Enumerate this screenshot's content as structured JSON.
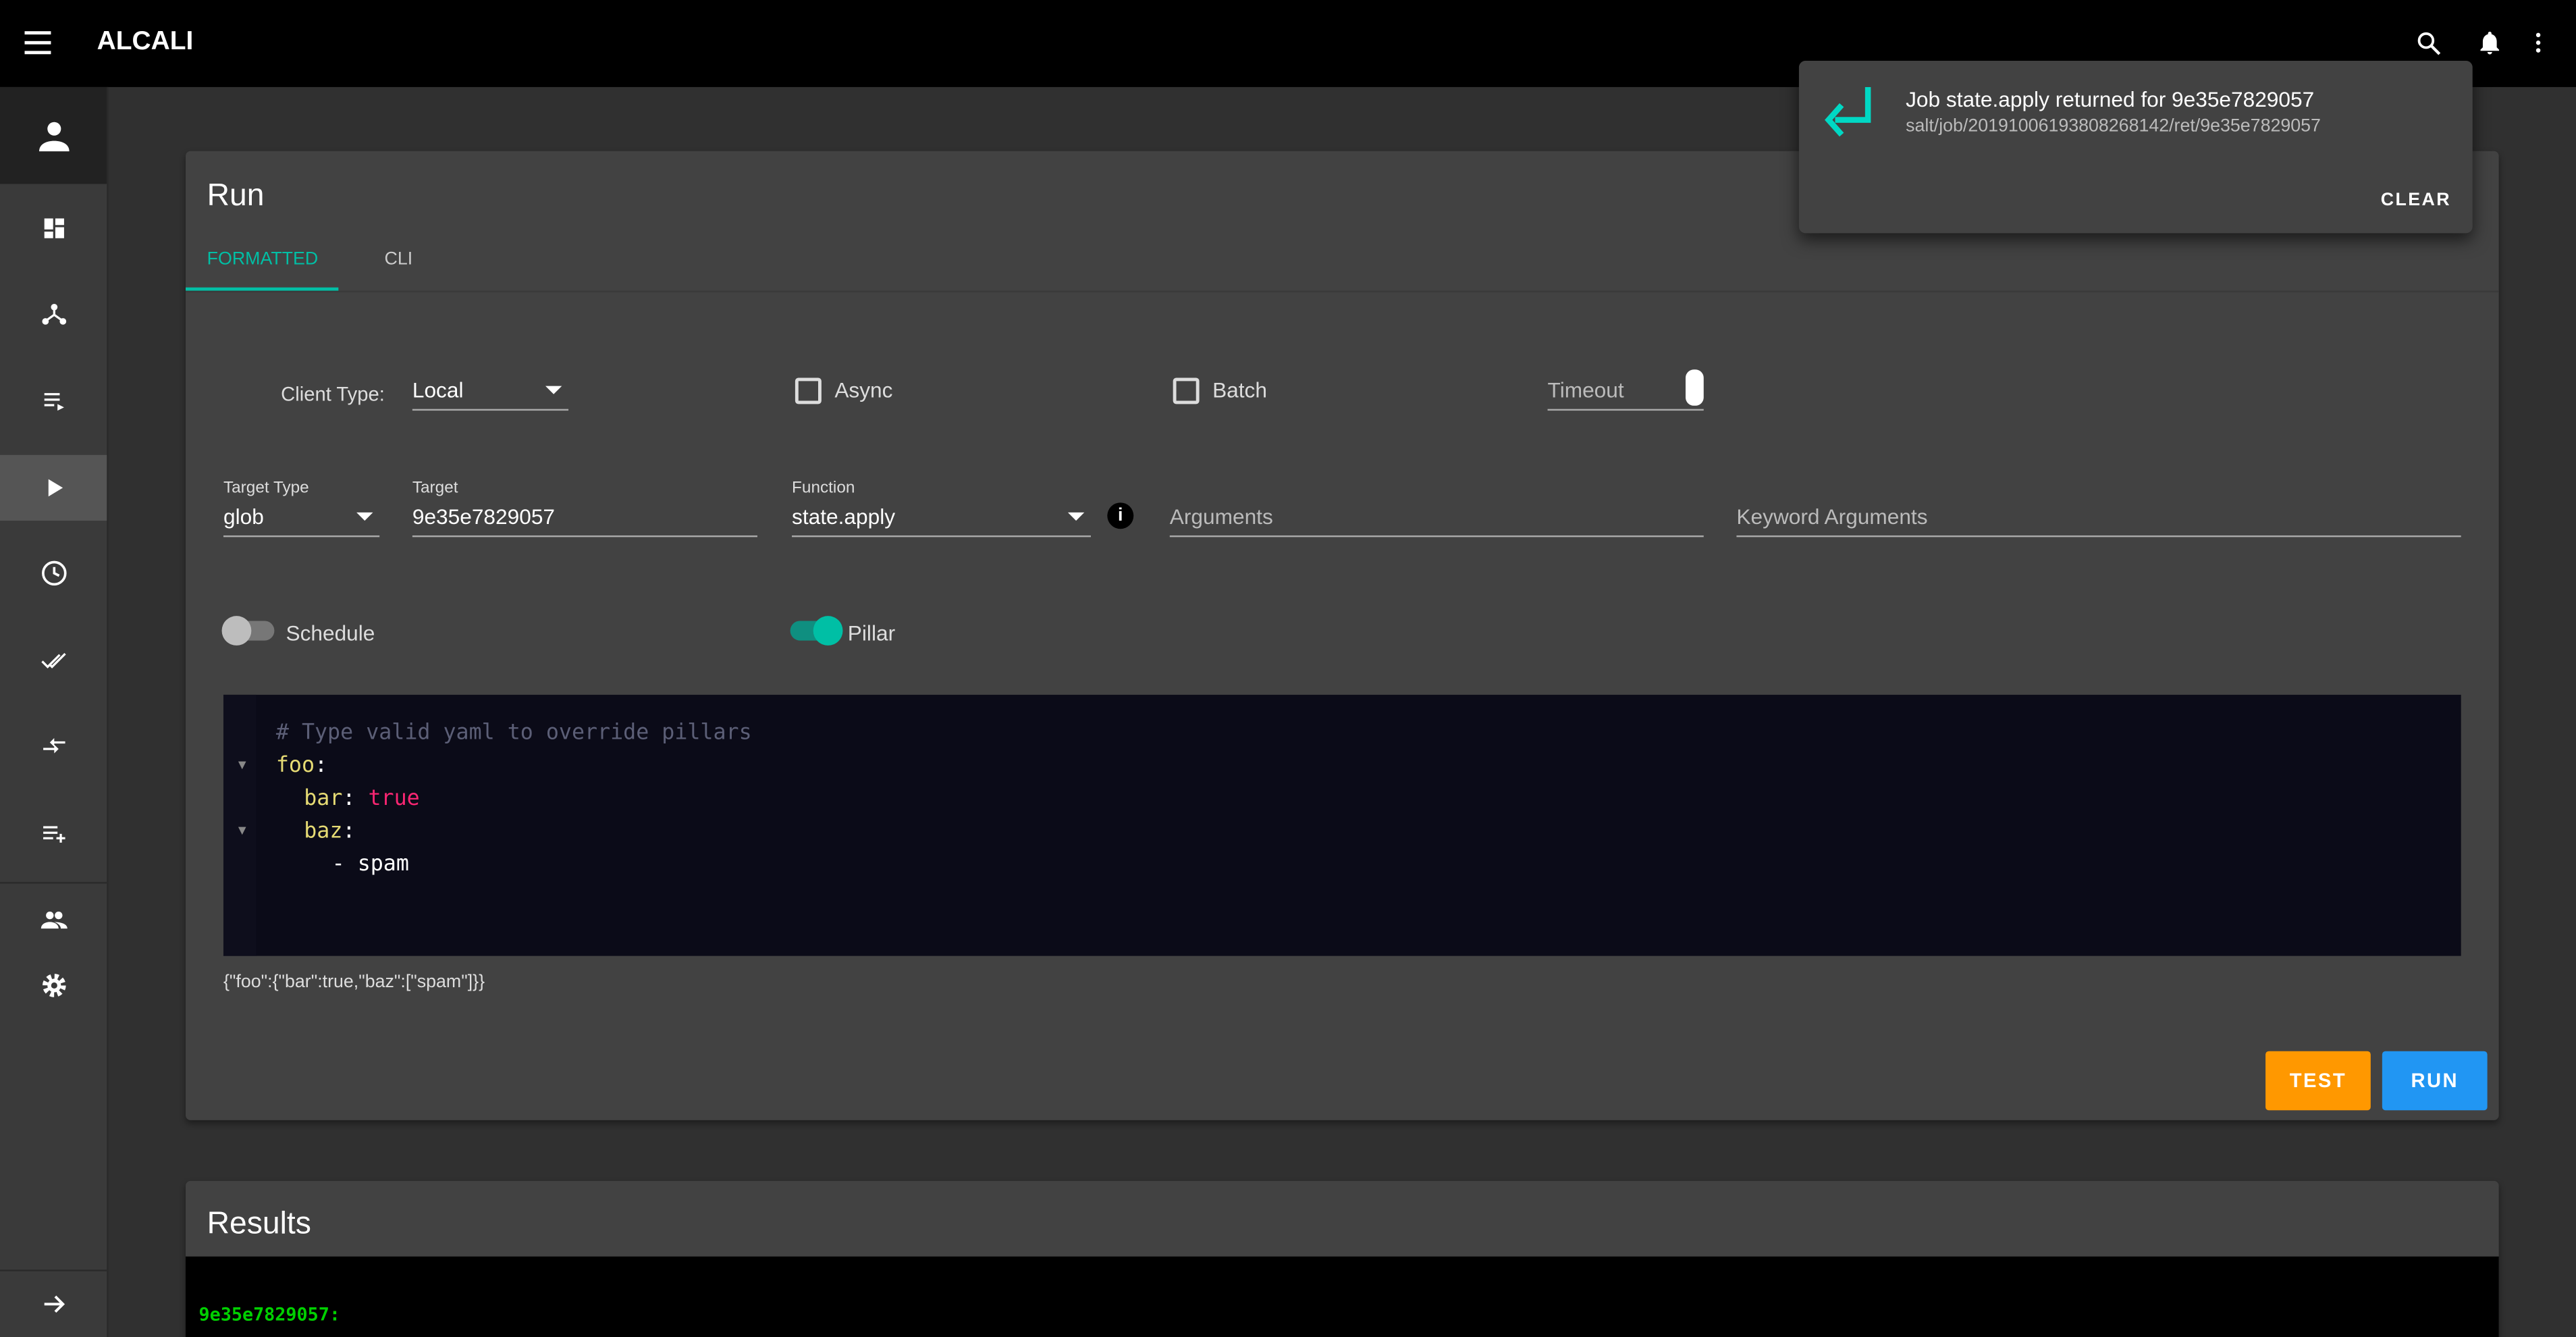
{
  "app": {
    "title": "ALCALI"
  },
  "topbar": {
    "icons": [
      "menu-icon",
      "search-icon",
      "bell-icon",
      "more-vert-icon"
    ]
  },
  "sidebar": {
    "items": [
      {
        "name": "profile",
        "icon": "person-icon"
      },
      {
        "name": "dashboard",
        "icon": "dashboard-icon"
      },
      {
        "name": "minions",
        "icon": "device-hub-icon"
      },
      {
        "name": "jobs",
        "icon": "list-icon"
      },
      {
        "name": "run",
        "icon": "play-icon",
        "active": true
      },
      {
        "name": "schedules",
        "icon": "clock-icon"
      },
      {
        "name": "conformity",
        "icon": "double-check-icon"
      },
      {
        "name": "events",
        "icon": "compare-arrows-icon"
      },
      {
        "name": "job-templates",
        "icon": "playlist-add-icon"
      },
      {
        "name": "users",
        "icon": "people-icon"
      },
      {
        "name": "settings",
        "icon": "gear-icon"
      },
      {
        "name": "expand",
        "icon": "arrow-right-icon"
      }
    ]
  },
  "notification": {
    "title": "Job state.apply returned for 9e35e7829057",
    "subtitle": "salt/job/20191006193808268142/ret/9e35e7829057",
    "action": "CLEAR",
    "icon": "return-arrow-icon",
    "accent": "#00d8c4"
  },
  "run": {
    "title": "Run",
    "tabs": [
      {
        "label": "FORMATTED",
        "active": true
      },
      {
        "label": "CLI"
      }
    ],
    "client_type_label": "Client Type:",
    "client_type": "Local",
    "async_label": "Async",
    "async": false,
    "batch_label": "Batch",
    "batch": false,
    "timeout_placeholder": "Timeout",
    "target_type_label": "Target Type",
    "target_type": "glob",
    "target_label": "Target",
    "target": "9e35e7829057",
    "function_label": "Function",
    "function": "state.apply",
    "arguments_placeholder": "Arguments",
    "kwargs_placeholder": "Keyword Arguments",
    "schedule_label": "Schedule",
    "schedule": false,
    "pillar_label": "Pillar",
    "pillar": true,
    "code": {
      "comment": "# Type valid yaml to override pillars",
      "l1": "foo",
      "l2k": "bar",
      "l2v": "true",
      "l3": "baz",
      "l4": "- spam"
    },
    "json_preview": "{\"foo\":{\"bar\":true,\"baz\":[\"spam\"]}}",
    "test_label": "TEST",
    "run_label": "RUN",
    "colors": {
      "accent": "#00bfa5",
      "test": "#ff9800",
      "run": "#2196f3"
    }
  },
  "results": {
    "title": "Results",
    "minion": "9e35e7829057:"
  }
}
